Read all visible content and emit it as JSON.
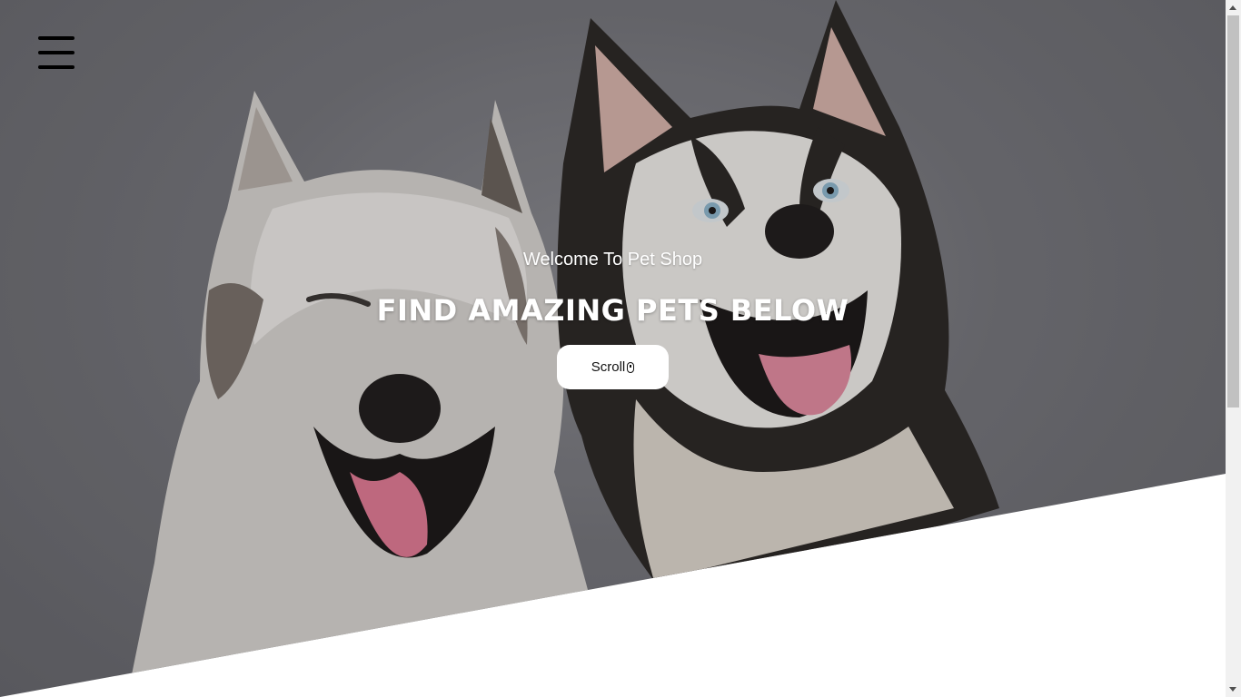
{
  "menu": {
    "icon": "hamburger-menu-icon"
  },
  "hero": {
    "welcome_text": "Welcome To Pet Shop",
    "headline": "FIND AMAZING PETS BELOW",
    "scroll_button_label": "Scroll",
    "scroll_button_icon": "mouse-icon",
    "background_image": "two-husky-dogs-photo"
  },
  "colors": {
    "accent_text": "#ffffff",
    "button_bg": "#ffffff",
    "button_text": "#111111",
    "menu_icon": "#000000"
  }
}
